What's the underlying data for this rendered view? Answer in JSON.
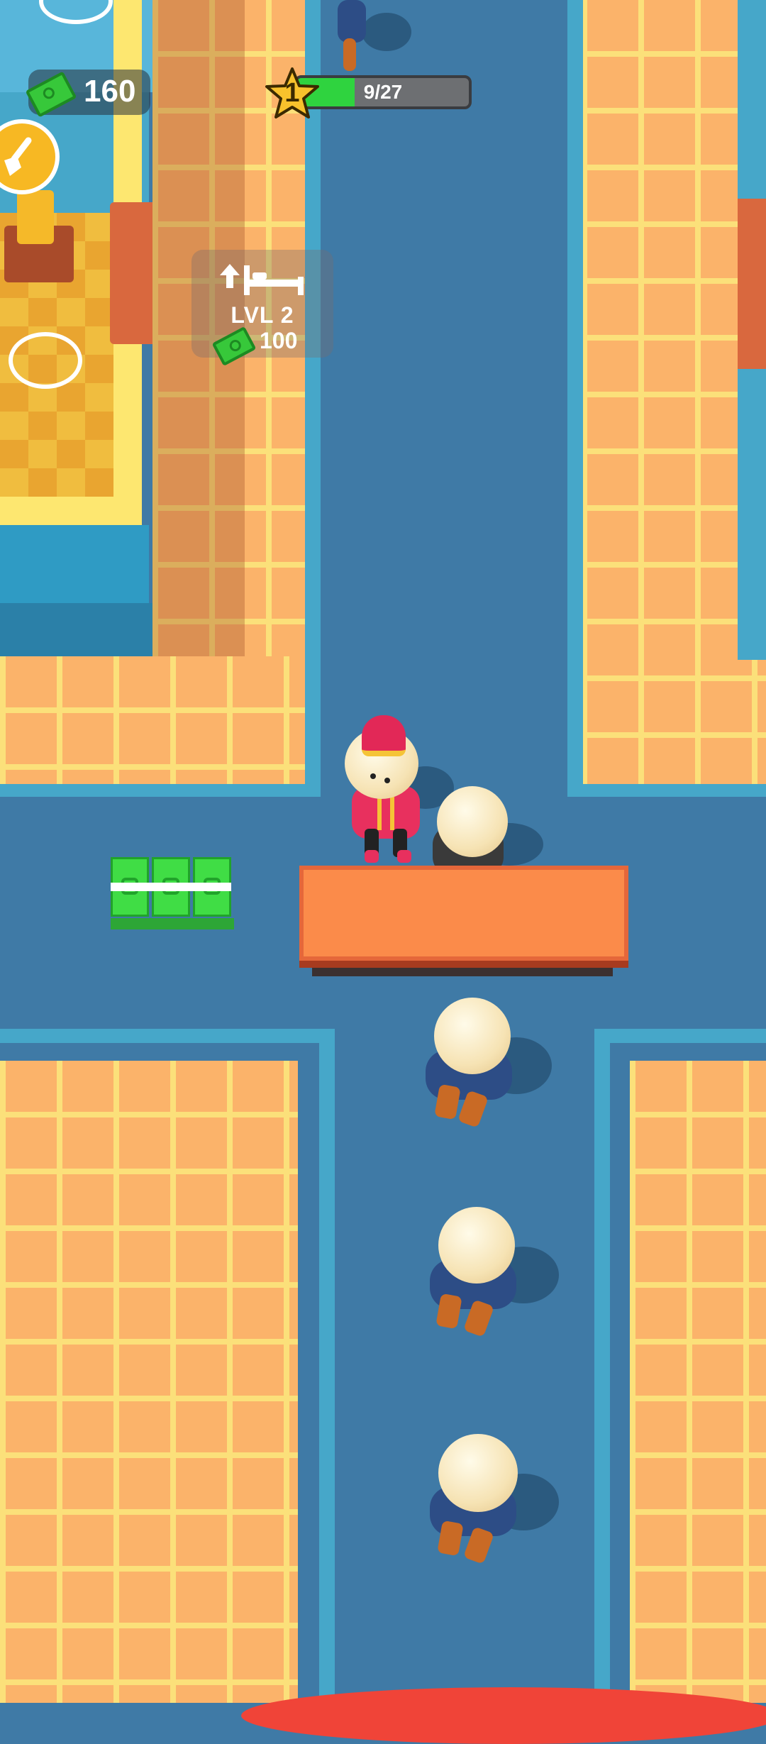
{
  "hud": {
    "cash_amount": "160",
    "level_number": "1",
    "progress_text": "9/27",
    "progress_value": 0.333
  },
  "upgrade": {
    "level_label": "LVL 2",
    "price": "100"
  },
  "icons": {
    "cash": "cash-icon",
    "star": "star-icon",
    "bed_upgrade": "bed-upgrade-icon",
    "broom": "broom-icon"
  },
  "colors": {
    "floor_blue": "#3f7aa6",
    "tile_orange": "#fbb36a",
    "tile_grid": "#fbe07a",
    "progress_green": "#2fd33f",
    "counter_orange": "#fb8b4a",
    "bellhop_red": "#e8305e"
  }
}
